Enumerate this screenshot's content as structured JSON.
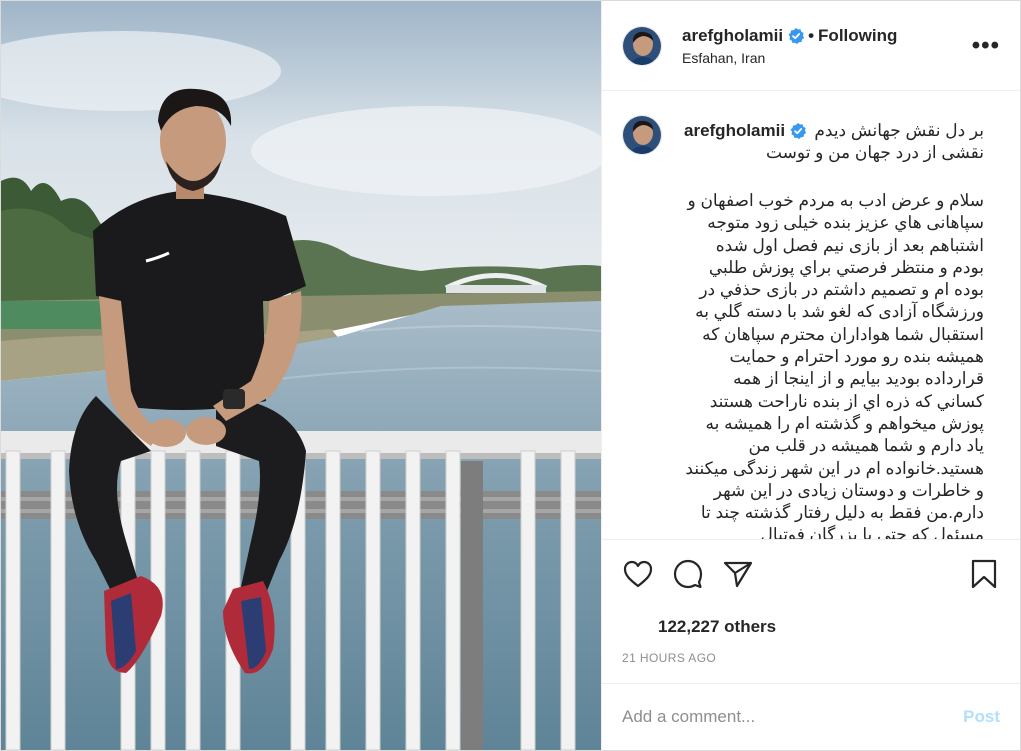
{
  "header": {
    "username": "arefgholamii",
    "separator": "•",
    "follow_label": "Following",
    "location": "Esfahan, Iran",
    "more_label": "•••"
  },
  "caption": {
    "username": "arefgholamii",
    "title_line1": "بر دل نقش جهانش دیدم",
    "title_line2": "نقشی از درد جهان من و توست",
    "body": "سلام و عرض ادب به مردم خوب اصفهان و سپاهانى هاي عزيز بنده خيلى زود متوجه اشتباهم بعد از بازی نیم فصل اول شده بودم و منتظر فرصتي براي پوزش طلبي بوده ام و تصميم داشتم در بازی حذفي در ورزشگاه آزادی که لغو شد با دسته گلي به استقبال شما هواداران محترم سپاهان که هميشه بنده رو مورد احترام و حمايت قرارداده بوديد بيايم و از اينجا از همه كساني كه ذره اي از بنده ناراحت هستند پوزش ميخواهم و گذشته ام را هميشه به ياد دارم و شما هميشه در قلب من هستيد.خانواده ام در این شهر زندگی میکنند و خاطرات و دوستان زیادی در این شهر دارم.من فقط به دلیل رفتار گذشته چند تا مسئول که حتی با بزرگان فوتبال"
  },
  "likes": {
    "text": "122,227 others"
  },
  "timestamp": "21 HOURS AGO",
  "comment_box": {
    "placeholder": "Add a comment...",
    "post_label": "Post"
  },
  "icons": {
    "verified": "verified-badge-icon",
    "like": "heart-icon",
    "comment": "comment-bubble-icon",
    "share": "paper-plane-icon",
    "save": "bookmark-icon",
    "more": "ellipsis-icon"
  },
  "colors": {
    "verified_blue": "#3897f0",
    "post_disabled": "#b2dffc",
    "muted_text": "#8e8e8e"
  }
}
